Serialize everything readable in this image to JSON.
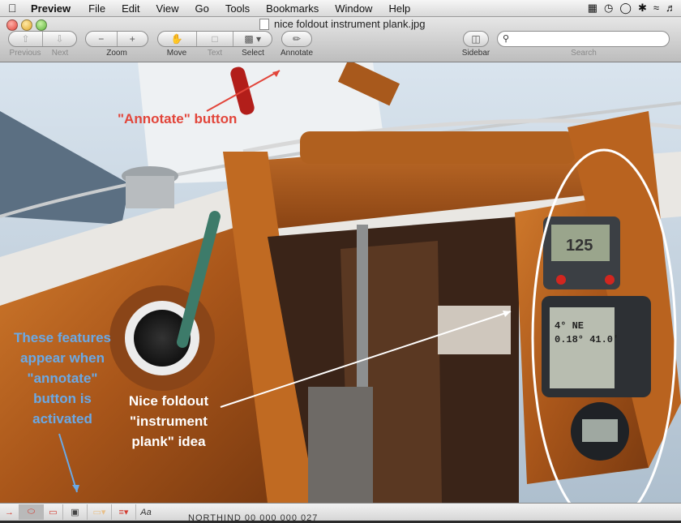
{
  "menubar": {
    "app_name": "Preview",
    "items": [
      "File",
      "Edit",
      "View",
      "Go",
      "Tools",
      "Bookmarks",
      "Window",
      "Help"
    ]
  },
  "window": {
    "title": "nice foldout instrument plank.jpg"
  },
  "toolbar": {
    "previous_label": "Previous",
    "next_label": "Next",
    "zoom_label": "Zoom",
    "move_label": "Move",
    "text_label": "Text",
    "select_label": "Select",
    "annotate_label": "Annotate",
    "sidebar_label": "Sidebar",
    "search_label": "Search",
    "search_value": ""
  },
  "annotations": {
    "annotate_button_note": "\"Annotate\" button",
    "features_note_lines": [
      "These features",
      "appear when",
      "\"annotate\"",
      "button is",
      "activated"
    ],
    "plank_note_lines": [
      "Nice foldout",
      "\"instrument",
      "plank\" idea"
    ]
  },
  "device_screens": {
    "autopilot_readout": "125",
    "gps_line1": "4°  NE",
    "gps_line2": "0.18°  41.0'"
  },
  "annotate_bar": {
    "tools": [
      "arrow-tool",
      "oval-tool",
      "rectangle-tool",
      "text-box-tool",
      "fill-color-tool",
      "line-style-tool",
      "font-tool"
    ],
    "font_label": "Aa",
    "below_text": "NORTHIND 00        000        000        027"
  },
  "colors": {
    "annotation_red": "#e2453a",
    "annotation_blue": "#6aa9e6",
    "annotation_white": "#ffffff",
    "teak": "#b5621e"
  }
}
